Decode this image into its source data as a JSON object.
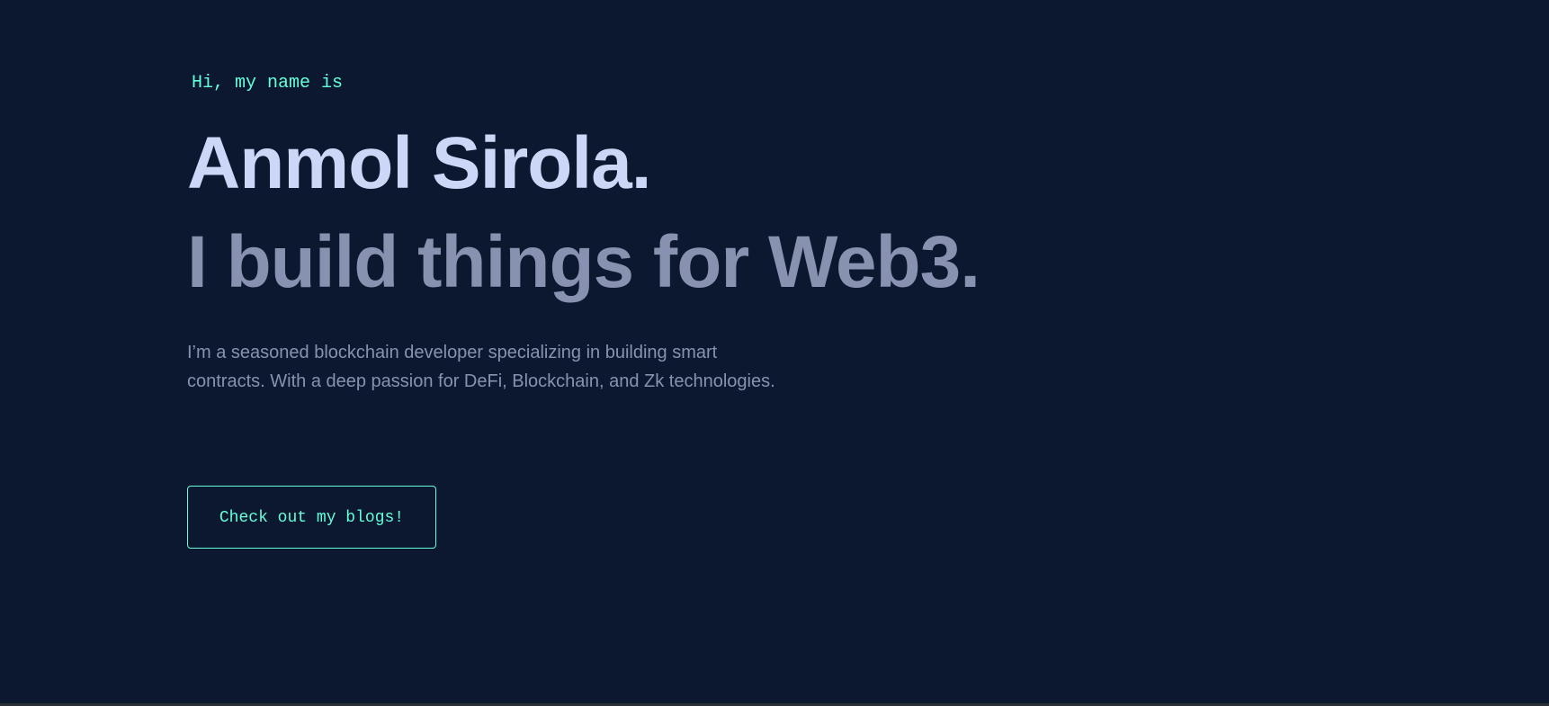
{
  "hero": {
    "intro": "Hi, my name is",
    "name": "Anmol Sirola.",
    "tagline": "I build things for Web3.",
    "bio": "I’m a seasoned blockchain developer specializing in building smart contracts. With a deep passion for DeFi, Blockchain, and Zk technologies.",
    "cta_label": "Check out my blogs!"
  },
  "colors": {
    "background": "#0b182f",
    "accent": "#64ffda",
    "heading": "#ccd6f6",
    "muted": "#8892b0"
  }
}
